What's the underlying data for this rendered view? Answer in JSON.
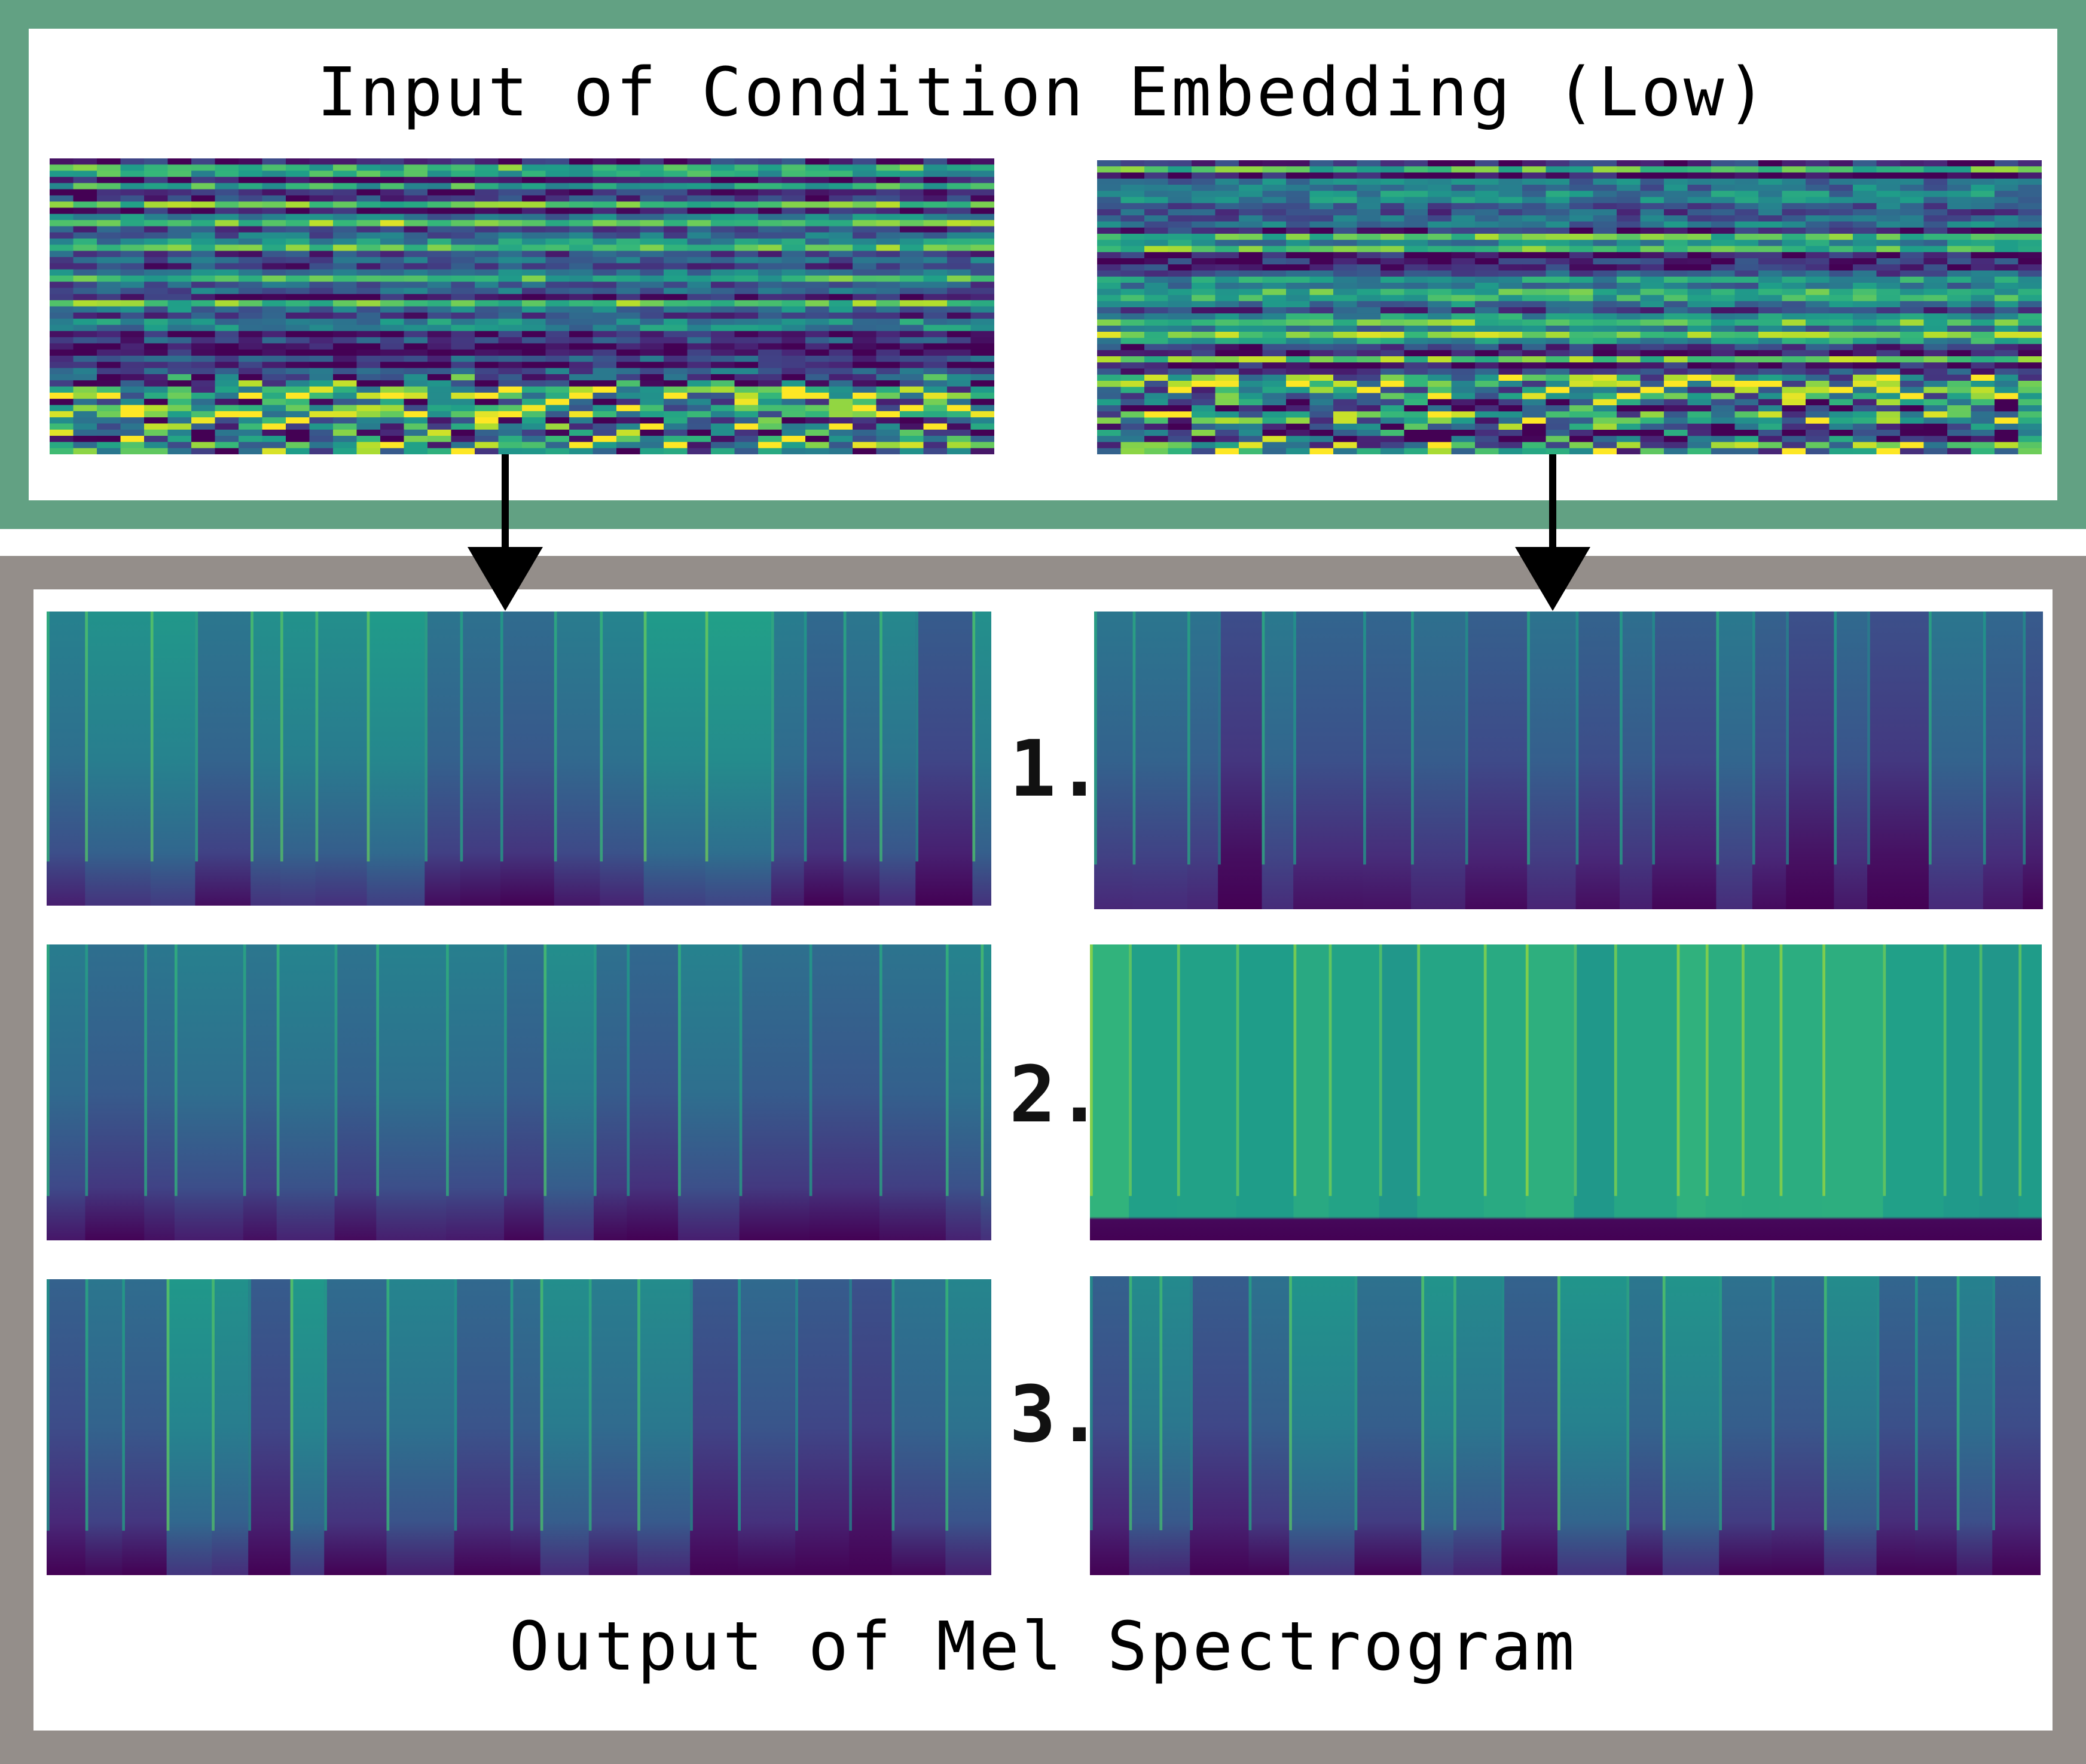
{
  "input_panel": {
    "title": "Input of Condition Embedding (Low)"
  },
  "output_panel": {
    "title": "Output of Mel Spectrogram",
    "rows": [
      {
        "label": "1."
      },
      {
        "label": "2."
      },
      {
        "label": "3."
      }
    ]
  },
  "colors": {
    "input_border": "#62a183",
    "output_border": "#948e8a",
    "colormap": "viridis",
    "arrow": "#000000"
  }
}
